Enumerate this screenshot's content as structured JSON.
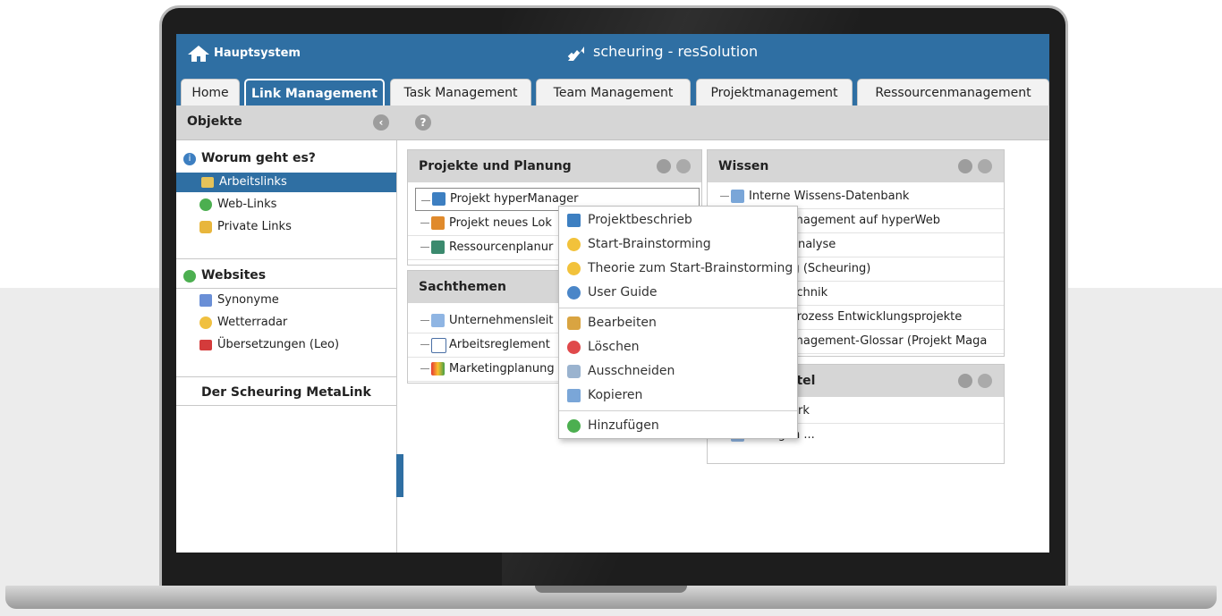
{
  "app": {
    "system_label": "Hauptsystem",
    "brand": "scheuring - resSolution"
  },
  "tabs": [
    {
      "label": "Home",
      "active": false
    },
    {
      "label": "Link Management",
      "active": true
    },
    {
      "label": "Task Management",
      "active": false
    },
    {
      "label": "Team Management",
      "active": false
    },
    {
      "label": "Projektmanagement",
      "active": false
    },
    {
      "label": "Ressourcenmanagement",
      "active": false
    }
  ],
  "objbar": {
    "title": "Objekte",
    "back_icon": "chevron-left-icon",
    "help_icon": "help-icon"
  },
  "sidebar": {
    "section1": {
      "title": "Worum geht es?",
      "items": [
        {
          "label": "Arbeitslinks",
          "selected": true
        },
        {
          "label": "Web-Links",
          "selected": false
        },
        {
          "label": "Private Links",
          "selected": false
        }
      ]
    },
    "section2": {
      "title": "Websites",
      "items": [
        {
          "label": "Synonyme"
        },
        {
          "label": "Wetterradar"
        },
        {
          "label": "Übersetzungen (Leo)"
        }
      ]
    },
    "section3": {
      "title": "Der Scheuring MetaLink"
    }
  },
  "panels": {
    "projekte": {
      "title": "Projekte und Planung",
      "rows": [
        "Projekt hyperManager",
        "Projekt neues Lok",
        "Ressourcenplanur"
      ]
    },
    "sachthemen": {
      "title": "Sachthemen",
      "rows": [
        "Unternehmensleit",
        "Arbeitsreglement",
        "Marketingplanung"
      ]
    },
    "wissen": {
      "title": "Wissen",
      "rows": [
        "Interne Wissens-Datenbank",
        "management auf hyperWeb",
        "nsanalyse",
        "ung (Scheuring)",
        "ntechnik",
        "rdprozess Entwicklungsprojekte",
        "management-Glossar (Projekt Maga"
      ]
    },
    "mittel": {
      "title": "nittel",
      "rows": [
        "fwerk",
        "Vorlagen ..."
      ]
    }
  },
  "context_menu": {
    "items": [
      {
        "label": "Projektbeschrieb",
        "icon": "book-icon"
      },
      {
        "label": "Start-Brainstorming",
        "icon": "bulb-icon"
      },
      {
        "label": "Theorie zum Start-Brainstorming",
        "icon": "bulb-icon"
      },
      {
        "label": "User Guide",
        "icon": "help-icon"
      },
      {
        "label": "Bearbeiten",
        "icon": "edit-icon"
      },
      {
        "label": "Löschen",
        "icon": "delete-icon"
      },
      {
        "label": "Ausschneiden",
        "icon": "scissors-icon"
      },
      {
        "label": "Kopieren",
        "icon": "copy-icon"
      },
      {
        "label": "Hinzufügen",
        "icon": "add-icon"
      }
    ]
  },
  "colors": {
    "accent": "#2f6fa3",
    "panel_header": "#d6d6d6"
  }
}
